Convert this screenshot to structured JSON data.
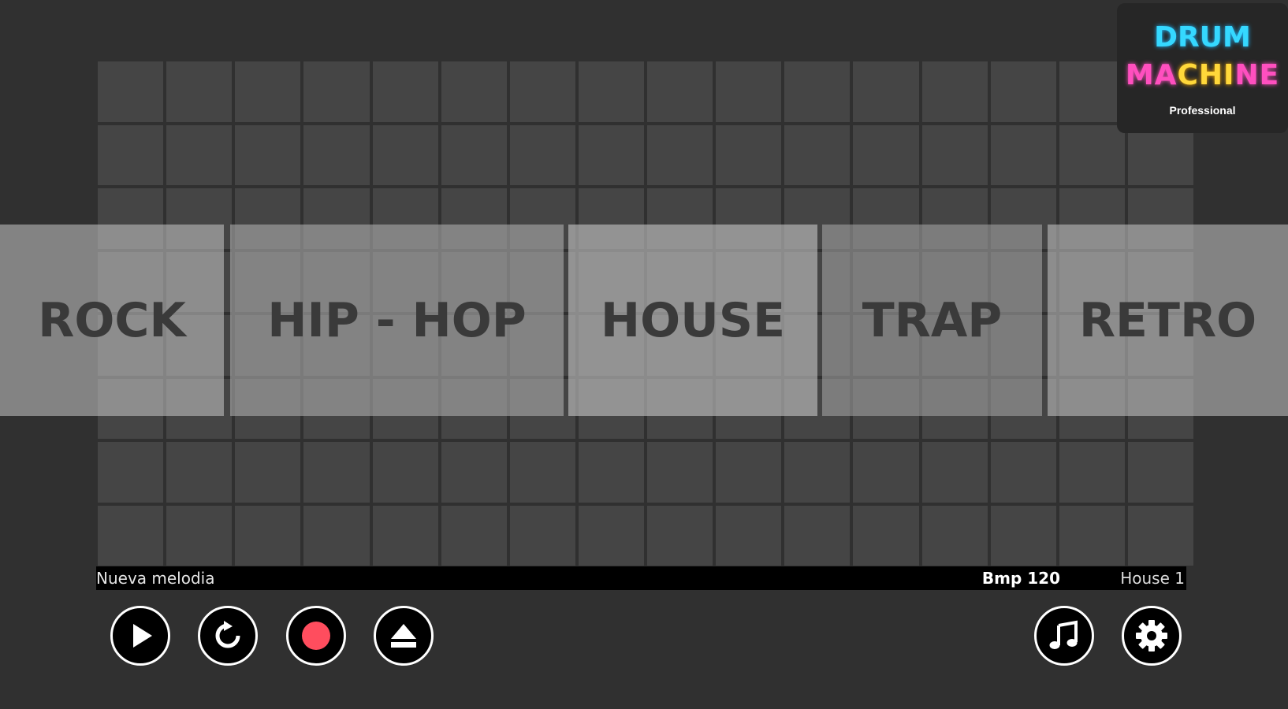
{
  "logo": {
    "line1": "DRUM",
    "line2_pink": "MA",
    "line2_yellow": "CHI",
    "line2_pink2": "NE",
    "line3": "Professional"
  },
  "genres": [
    {
      "label": "ROCK"
    },
    {
      "label": "HIP - HOP"
    },
    {
      "label": "HOUSE"
    },
    {
      "label": "TRAP"
    },
    {
      "label": "RETRO"
    }
  ],
  "status": {
    "song_name": "Nueva melodia",
    "bpm": "Bmp 120",
    "preset": "House 1"
  },
  "controls": {
    "play": "play-icon",
    "reset": "reset-icon",
    "record": "record-icon",
    "eject": "eject-icon",
    "music": "music-note-icon",
    "settings": "gear-icon"
  },
  "colors": {
    "background": "#303030",
    "pad": "#454545",
    "record": "#ff4d5e",
    "logo_cyan": "#35d8ff",
    "logo_pink": "#ff4fbf",
    "logo_yellow": "#ffd83a"
  }
}
